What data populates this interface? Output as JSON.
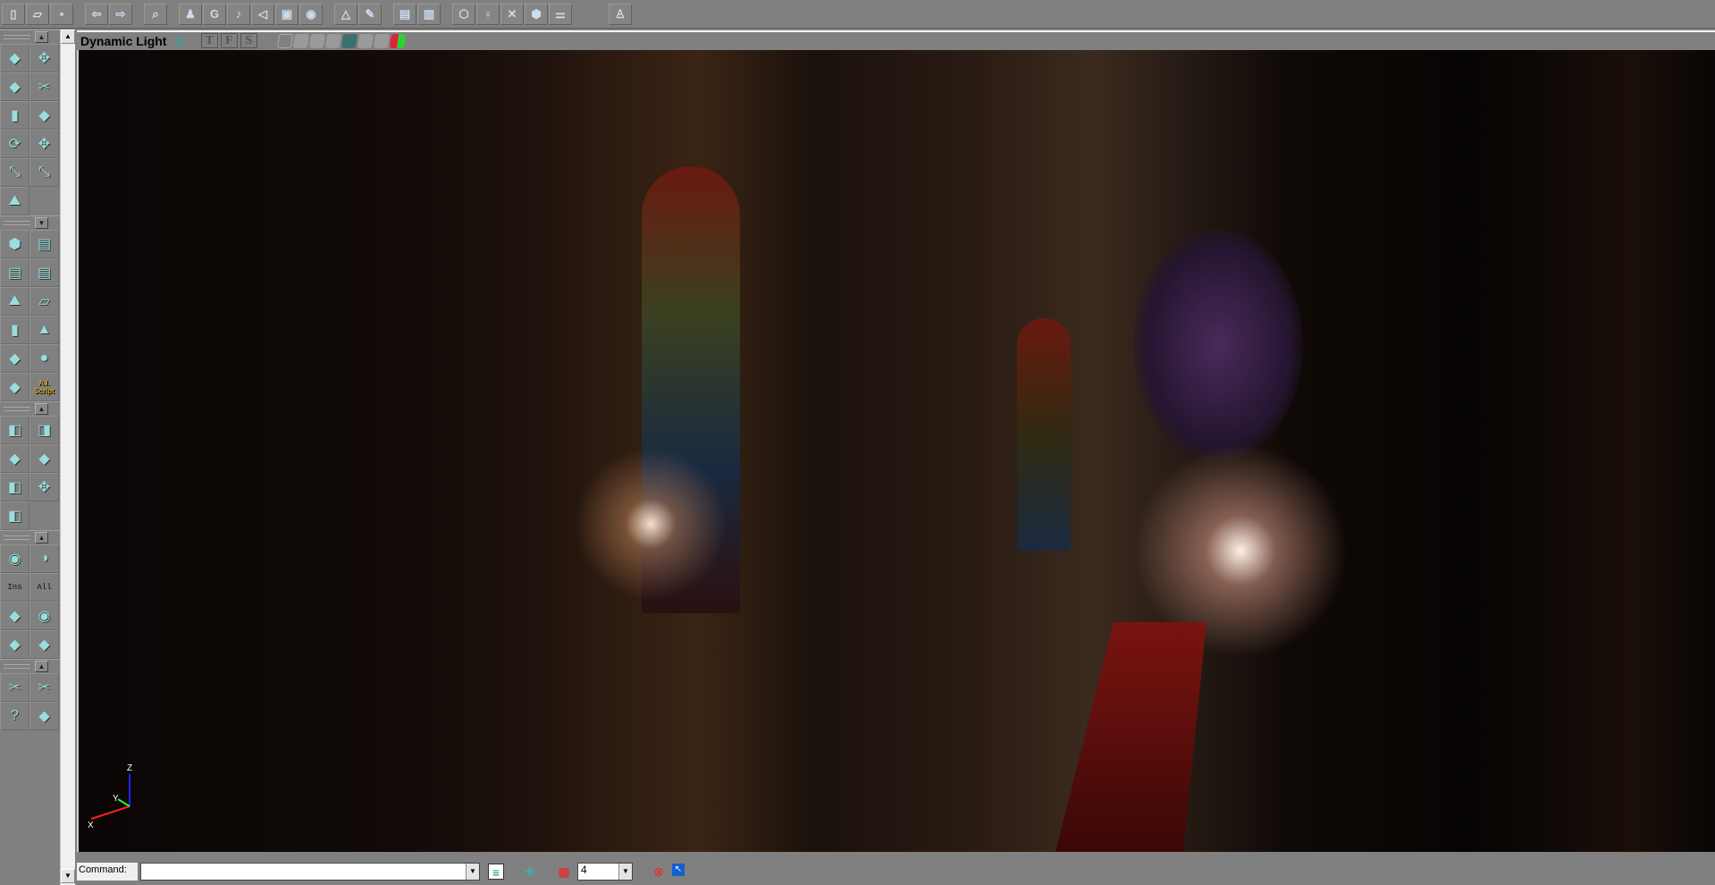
{
  "toolbar": {
    "groups": [
      [
        {
          "icon": "new-file-icon",
          "g": "▯"
        },
        {
          "icon": "open-folder-icon",
          "g": "▱"
        },
        {
          "icon": "save-icon",
          "g": "▪"
        }
      ],
      [
        {
          "icon": "undo-arrow-icon",
          "g": "⇦"
        },
        {
          "icon": "redo-arrow-icon",
          "g": "⇨"
        }
      ],
      [
        {
          "icon": "binoculars-search-icon",
          "g": "⌕"
        }
      ],
      [
        {
          "icon": "actor-browser-icon",
          "g": "♟"
        },
        {
          "icon": "group-browser-icon",
          "g": "G"
        },
        {
          "icon": "music-browser-icon",
          "g": "♪"
        },
        {
          "icon": "sound-browser-icon",
          "g": "◁"
        },
        {
          "icon": "texture-browser-icon",
          "g": "▣"
        },
        {
          "icon": "eye-mesh-browser-icon",
          "g": "◉"
        }
      ],
      [
        {
          "icon": "vertex-editing-icon",
          "g": "△"
        },
        {
          "icon": "terrain-editing-icon",
          "g": "✎"
        }
      ],
      [
        {
          "icon": "actor-properties-icon",
          "g": "▤"
        },
        {
          "icon": "surface-properties-icon",
          "g": "▥"
        }
      ],
      [
        {
          "icon": "build-geometry-icon",
          "g": "⬡"
        },
        {
          "icon": "build-lighting-icon",
          "g": "♀"
        },
        {
          "icon": "build-paths-icon",
          "g": "✕"
        },
        {
          "icon": "build-all-icon",
          "g": "⬢"
        },
        {
          "icon": "build-options-icon",
          "g": "⚌"
        }
      ],
      [
        {
          "icon": "play-level-joystick-icon",
          "g": "♙"
        }
      ]
    ]
  },
  "viewport": {
    "title": "Dynamic Light",
    "mode_icon": "viewport-locked-icon",
    "view_buttons": [
      "T",
      "F",
      "S"
    ],
    "render_modes": [
      "wireframe-mode-icon",
      "zone-mode-icon",
      "bsp-cuts-mode-icon",
      "textured-mode-icon",
      "dynamic-light-mode-icon",
      "lighting-only-mode-icon",
      "depth-complexity-mode-icon",
      "texture-usage-mode-icon"
    ],
    "axes": {
      "x": "X",
      "y": "Y",
      "z": "Z"
    },
    "colors": {
      "x_axis": "#ff2020",
      "y_axis": "#20ff20",
      "z_axis": "#2020ff"
    }
  },
  "left_panel": {
    "sections": [
      {
        "arrow": "▲",
        "rows": [
          [
            "camera-browse-icon",
            "move-camera-icon"
          ],
          [
            "texture-pan-icon",
            "brush-clip-icon"
          ],
          [
            "cylinder-rotate-icon",
            "vertex-icon"
          ],
          [
            "rotate-icon",
            "move-actor-icon"
          ],
          [
            "scale-icon",
            "no-scale-icon"
          ],
          [
            "terrain-mode-icon"
          ]
        ]
      },
      {
        "arrow": "▼",
        "rows": [
          [
            "cube-builder-icon",
            "stairs-builder-icon"
          ],
          [
            "linear-stairs-icon",
            "curved-stairs-icon"
          ],
          [
            "terrain-builder-icon",
            "sheet-builder-icon"
          ],
          [
            "cylinder-builder-icon",
            "cone-builder-icon"
          ],
          [
            "volumetric-builder-icon",
            "sphere-builder-icon"
          ],
          [
            "tetrahedron-builder-icon",
            {
              "icon": "ai-script-icon",
              "text": "A.I. Script"
            }
          ]
        ]
      },
      {
        "arrow": "▲",
        "rows": [
          [
            "add-brush-icon",
            "subtract-brush-icon"
          ],
          [
            "intersect-brush-icon",
            "deintersect-brush-icon"
          ],
          [
            "add-special-brush-icon",
            "add-mover-icon"
          ],
          [
            "add-volume-icon"
          ]
        ]
      },
      {
        "arrow": "▲",
        "rows": [
          [
            "show-selected-icon",
            "hide-selected-icon"
          ],
          [
            {
              "icon": "select-inside-icon",
              "text": "Ins"
            },
            {
              "icon": "select-all-icon",
              "text": "All"
            }
          ],
          [
            "invert-selection-icon",
            "show-all-icon"
          ],
          [
            "align-grid-icon",
            "snap-vertices-icon"
          ]
        ]
      },
      {
        "arrow": "▲",
        "rows": [
          [
            "camera-clip-icon",
            "brush-clip-split-icon"
          ],
          [
            "help-icon",
            "navigation-icon"
          ]
        ]
      }
    ]
  },
  "bottom": {
    "command_label": "Command:",
    "command_value": "",
    "grid_size": "4",
    "icons": [
      "log-window-icon",
      "camera-pivot-icon",
      "grid-toggle-icon",
      "rotation-grid-icon",
      "maximize-viewport-icon"
    ]
  }
}
